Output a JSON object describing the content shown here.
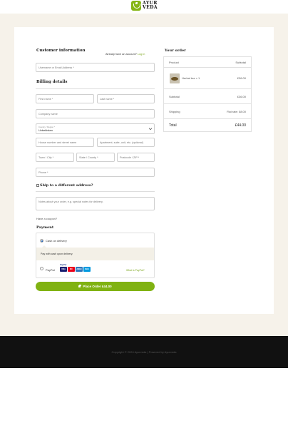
{
  "brand": {
    "name_line1": "AYUR",
    "name_line2": "VEDA",
    "accent": "#80b212"
  },
  "customer": {
    "title": "Customer information",
    "have_account": "Already have an account?",
    "login_link": "Log in",
    "username_placeholder": "Username or Email Address *"
  },
  "billing": {
    "title": "Billing details",
    "first_name": "First name *",
    "last_name": "Last name *",
    "company": "Company name",
    "country_label": "Country / Region *",
    "country_value": "Uzbekistan",
    "street": "House number and street name",
    "apartment": "Apartment, suite, unit, etc. (optional)",
    "town": "Town / City *",
    "state": "State / County *",
    "postcode": "Postcode / ZIP *",
    "phone": "Phone *"
  },
  "ship_different": "Ship to a different address?",
  "order_notes_placeholder": "Notes about your order, e.g. special notes for delivery.",
  "coupon_link": "Have a coupon?",
  "payment": {
    "title": "Payment",
    "cod_label": "Cash on delivery",
    "cod_description": "Pay with cash upon delivery.",
    "paypal_label": "PayPal",
    "paypal_badge": "PayPal",
    "what_is_paypal": "What is PayPal?",
    "card_brands": [
      "VISA",
      "MC",
      "AMEX",
      "MAE"
    ]
  },
  "place_order_label": "Place Order £44.00",
  "order": {
    "title": "Your order",
    "col_product": "Product",
    "col_subtotal": "Subtotal",
    "item_name": "Herbal tea × 1",
    "item_price": "£36.00",
    "subtotal_label": "Subtotal",
    "subtotal_value": "£36.00",
    "shipping_label": "Shipping",
    "shipping_value": "Flat rate: £8.00",
    "total_label": "Total",
    "total_value": "£44.00"
  },
  "footer": {
    "copyright": "Copyright © 2024 Ayurveda | Powered by Ayurveda"
  }
}
